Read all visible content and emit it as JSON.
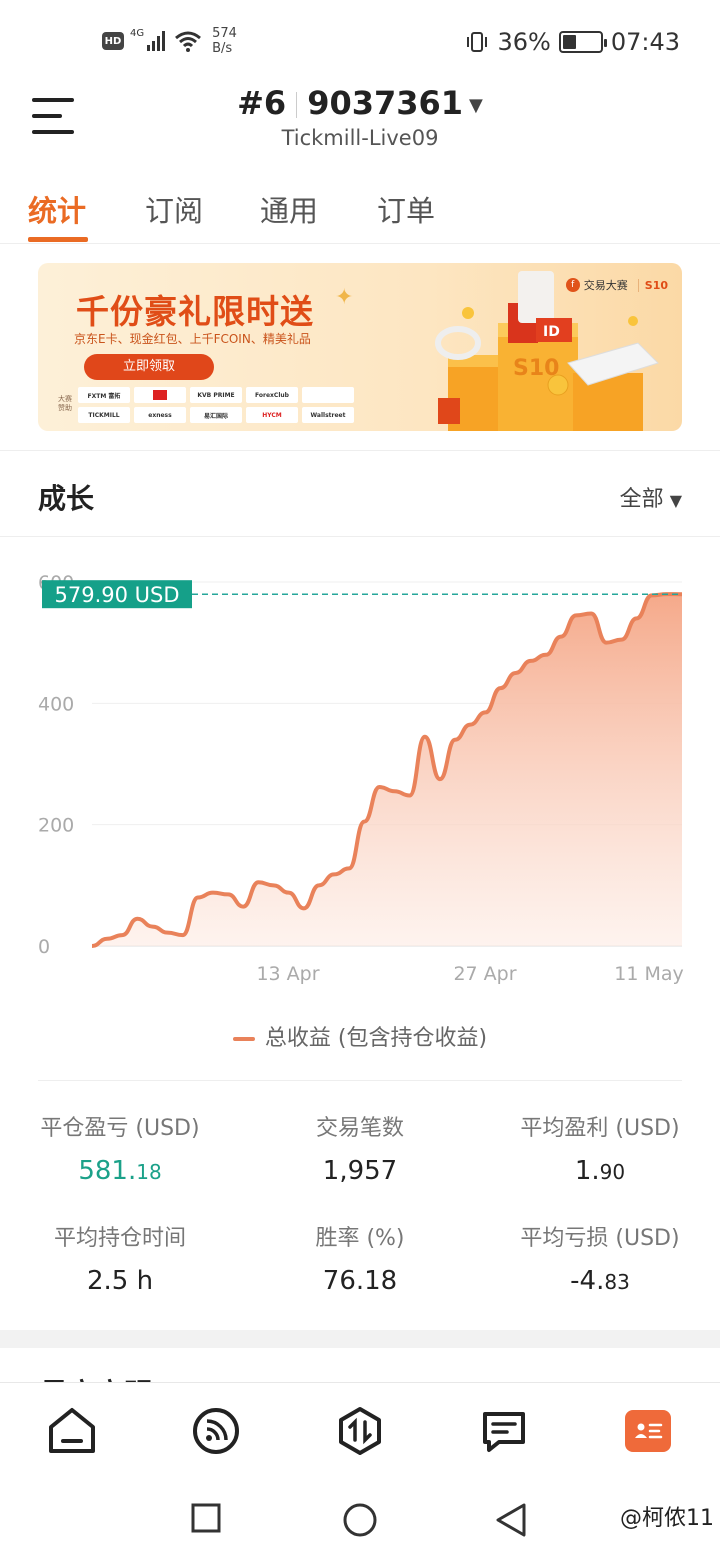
{
  "status_bar": {
    "hd": "HD",
    "network": "4G",
    "speed_value": "574",
    "speed_unit": "B/s",
    "battery_percent": "36%",
    "battery_level": 0.36,
    "time": "07:43"
  },
  "header": {
    "account_number": "#6",
    "account_id": "9037361",
    "server": "Tickmill-Live09"
  },
  "tabs": [
    "统计",
    "订阅",
    "通用",
    "订单"
  ],
  "active_tab": 0,
  "banner": {
    "title": "千份豪礼限时送",
    "subtitle": "京东E卡、现金红包、上千FCOIN、精美礼品",
    "button": "立即领取",
    "sponsor_label": "大赛赞助",
    "brand": "交易大赛",
    "brand_tag": "S10",
    "logos": [
      "FXTM 富拓",
      "",
      "KVB PRIME",
      "ForexClub",
      "",
      "TICKMILL",
      "exness",
      "易汇国际",
      "HYCM",
      "Wallstreet"
    ]
  },
  "growth": {
    "title": "成长",
    "filter": "全部"
  },
  "chart_data": {
    "type": "area",
    "current_value_label": "579.90 USD",
    "current_value": 579.9,
    "ylim": [
      0,
      600
    ],
    "yticks": [
      0,
      200,
      400,
      600
    ],
    "xtick_labels": [
      "13 Apr",
      "27 Apr",
      "11 May"
    ],
    "legend": "总收益 (包含持仓收益)",
    "series": [
      {
        "name": "总收益 (包含持仓收益)",
        "values": [
          0,
          12,
          18,
          45,
          32,
          22,
          18,
          80,
          88,
          85,
          65,
          105,
          100,
          88,
          62,
          100,
          118,
          128,
          205,
          262,
          255,
          248,
          345,
          275,
          340,
          365,
          385,
          425,
          450,
          470,
          480,
          510,
          545,
          548,
          500,
          505,
          540,
          578,
          580,
          579.9
        ]
      }
    ],
    "grid": true
  },
  "stats": [
    {
      "label": "平仓盈亏 (USD)",
      "int": "581.",
      "dec": "18",
      "color": "#1ba189"
    },
    {
      "label": "交易笔数",
      "int": "1,957",
      "dec": ""
    },
    {
      "label": "平均盈利 (USD)",
      "int": "1.",
      "dec": "90"
    },
    {
      "label": "平均持仓时间",
      "int": "2.5 h",
      "dec": ""
    },
    {
      "label": "胜率 (%)",
      "int": "76.18",
      "dec": ""
    },
    {
      "label": "平均亏损 (USD)",
      "int": "-4.",
      "dec": "83"
    }
  ],
  "next_section_title": "最高高明",
  "bottom_nav": [
    "home-icon",
    "feed-icon",
    "trade-icon",
    "message-icon",
    "profile-icon"
  ],
  "watermark": "@柯侬11"
}
